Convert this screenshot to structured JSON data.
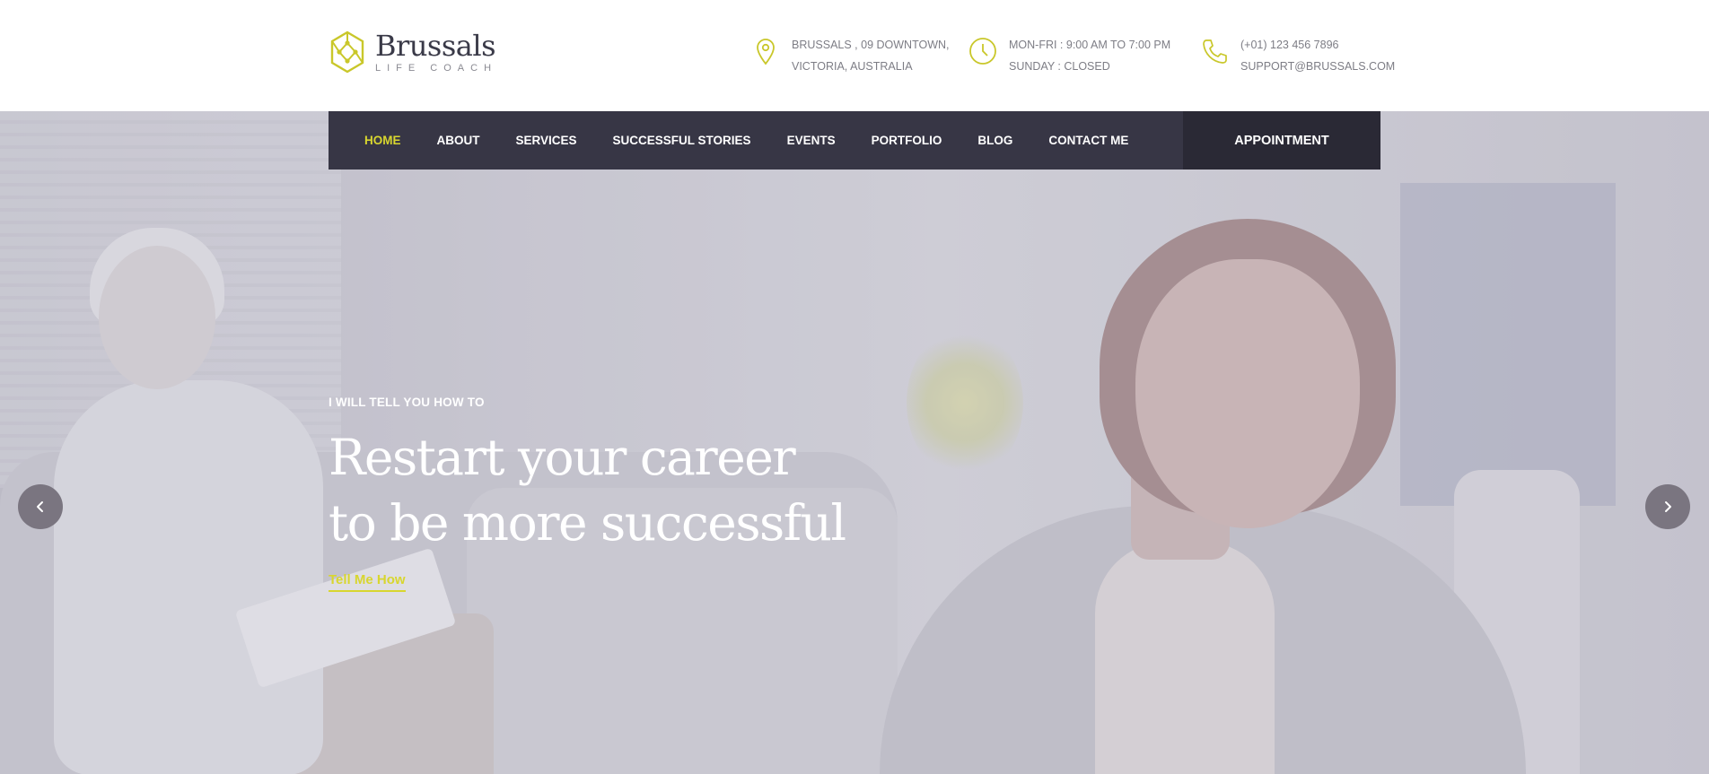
{
  "brand": {
    "name": "Brussals",
    "tagline": "LIFE COACH",
    "accent_color": "#d8d62f"
  },
  "header_info": {
    "address": {
      "icon": "map-pin-icon",
      "line1": "BRUSSALS , 09 DOWNTOWN,",
      "line2": "VICTORIA, AUSTRALIA"
    },
    "hours": {
      "icon": "clock-icon",
      "line1": "MON-FRI : 9:00 AM TO 7:00 PM",
      "line2": "SUNDAY : CLOSED"
    },
    "contact": {
      "icon": "phone-icon",
      "line1": "(+01) 123 456 7896",
      "line2": "SUPPORT@BRUSSALS.COM"
    }
  },
  "nav": {
    "items": [
      {
        "label": "HOME",
        "active": true
      },
      {
        "label": "ABOUT",
        "active": false
      },
      {
        "label": "SERVICES",
        "active": false
      },
      {
        "label": "SUCCESSFUL STORIES",
        "active": false
      },
      {
        "label": "EVENTS",
        "active": false
      },
      {
        "label": "PORTFOLIO",
        "active": false
      },
      {
        "label": "BLOG",
        "active": false
      },
      {
        "label": "CONTACT ME",
        "active": false
      }
    ],
    "cta_label": "APPOINTMENT",
    "background": "#373645",
    "cta_background": "#2a2935"
  },
  "hero": {
    "kicker": "I WILL TELL YOU HOW TO",
    "headline_line1": "Restart your career",
    "headline_line2": "to be more successful",
    "link_label": "Tell Me How",
    "prev_icon": "chevron-left-icon",
    "next_icon": "chevron-right-icon"
  }
}
